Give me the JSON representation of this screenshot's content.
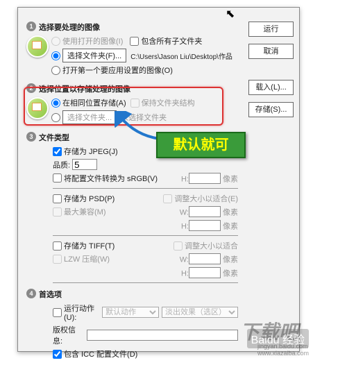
{
  "buttons": {
    "run": "运行",
    "cancel": "取消",
    "load": "载入(L)...",
    "save": "存储(S)..."
  },
  "sect1": {
    "title": "选择要处理的图像",
    "opt_open": "使用打开的图像(I)",
    "chk_subfolders": "包含所有子文件夹",
    "btn_select_folder": "选择文件夹(F)...",
    "path": "C:\\Users\\Jason Liu\\Desktop\\作品",
    "opt_first": "打开第一个要应用设置的图像(O)"
  },
  "sect2": {
    "title": "选择位置以存储处理的图像",
    "opt_same": "在相同位置存储(A)",
    "chk_keep": "保持文件夹结构",
    "btn_select": "选择文件夹...",
    "hint": "未选择文件夹"
  },
  "sect3": {
    "title": "文件类型",
    "chk_jpeg": "存储为 JPEG(J)",
    "quality_label": "品质:",
    "quality_val": "5",
    "chk_srgb": "将配置文件转换为 sRGB(V)",
    "h_label": "H:",
    "w_label": "W:",
    "h_label2": "H:",
    "unit": "像素",
    "chk_psd": "存储为 PSD(P)",
    "chk_maxcompat": "最大兼容(M)",
    "chk_resize_psd": "调整大小以适合(E)",
    "chk_tiff": "存储为 TIFF(T)",
    "chk_lzw": "LZW 压缩(W)",
    "chk_resize_tiff": "调整大小以适合"
  },
  "sect4": {
    "title": "首选项",
    "chk_action": "运行动作(U):",
    "action_sel": "默认动作",
    "fade_sel": "淡出效果（选区）",
    "copyright": "版权信息:",
    "chk_icc": "包含 ICC 配置文件(D)"
  },
  "callout": "默认就可",
  "wm": {
    "logo": "下载吧",
    "baidu": "Baidu 经验",
    "url": "jingyan.baidu.com\nwww.xiazaiba.com"
  }
}
